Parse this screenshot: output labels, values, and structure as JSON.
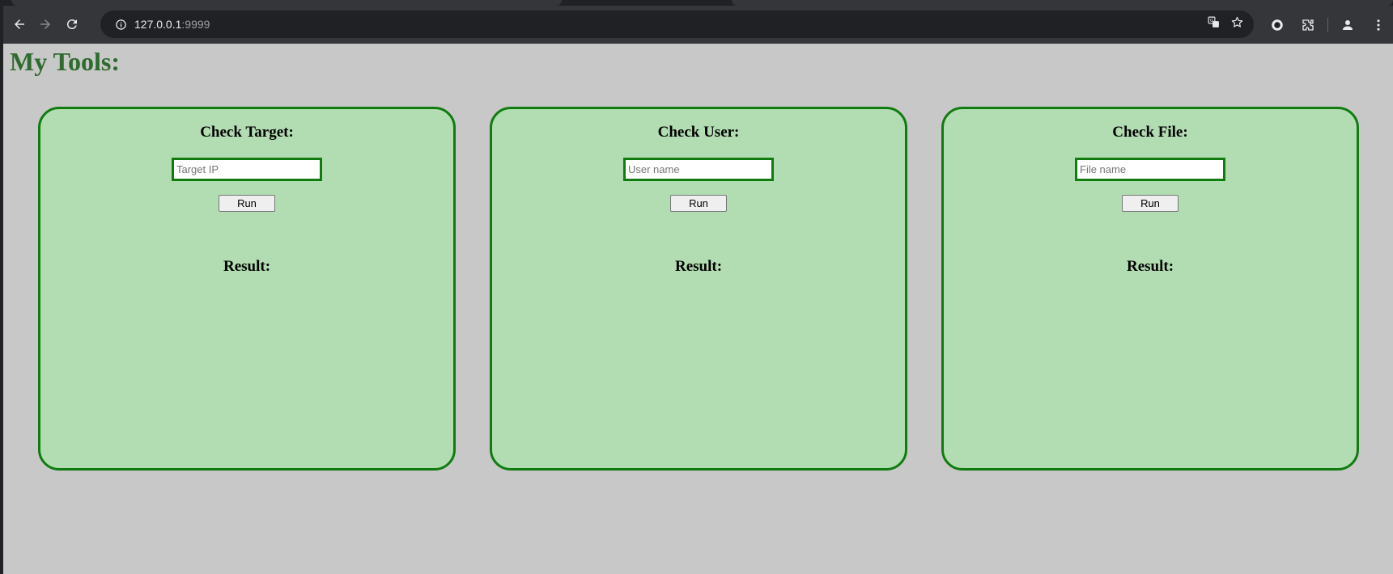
{
  "browser": {
    "url_host": "127.0.0.1",
    "url_port": ":9999"
  },
  "page": {
    "title": "My Tools:"
  },
  "cards": [
    {
      "title": "Check Target:",
      "input_placeholder": "Target IP",
      "input_value": "",
      "button_label": "Run",
      "result_label": "Result:"
    },
    {
      "title": "Check User:",
      "input_placeholder": "User name",
      "input_value": "",
      "button_label": "Run",
      "result_label": "Result:"
    },
    {
      "title": "Check File:",
      "input_placeholder": "File name",
      "input_value": "",
      "button_label": "Run",
      "result_label": "Result:"
    }
  ],
  "colors": {
    "page_bg": "#c8c8c8",
    "title": "#2e6b2e",
    "card_bg": "#b2ddb2",
    "card_border": "#107c10"
  },
  "icons": [
    "back-arrow-icon",
    "forward-arrow-icon",
    "reload-icon",
    "site-info-icon",
    "translate-icon",
    "bookmark-star-icon",
    "record-icon",
    "extensions-icon",
    "profile-icon",
    "menu-kebab-icon"
  ]
}
